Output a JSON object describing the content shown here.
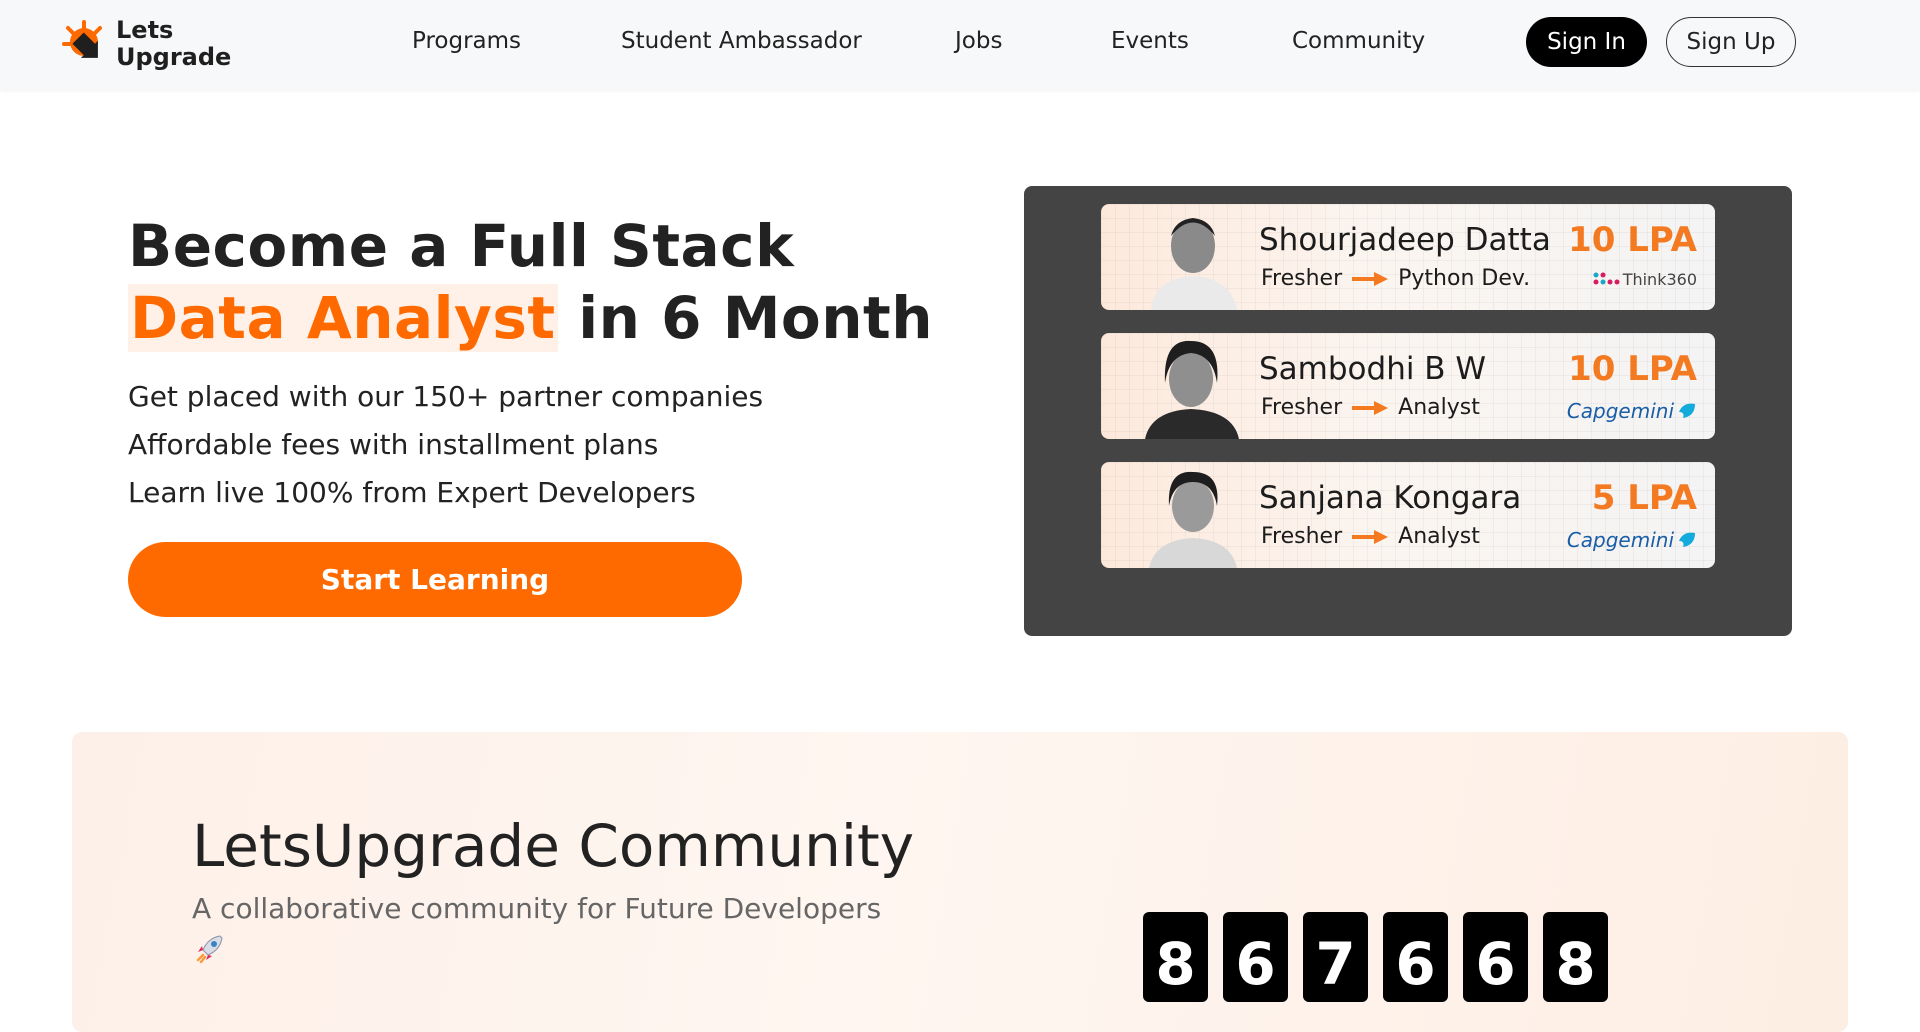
{
  "header": {
    "logo_line1": "Lets",
    "logo_line2": "Upgrade",
    "nav": [
      "Programs",
      "Student Ambassador",
      "Jobs",
      "Events",
      "Community"
    ],
    "sign_in": "Sign In",
    "sign_up": "Sign Up"
  },
  "hero": {
    "title_line1": "Become a Full Stack",
    "title_highlight": "Data Analyst",
    "title_line2_rest": " in 6 Month",
    "lines": [
      "Get placed with our 150+ partner companies",
      "Affordable fees with installment plans",
      "Learn live 100% from Expert Developers"
    ],
    "cta": "Start Learning"
  },
  "placements": [
    {
      "name": "Shourjadeep Datta",
      "from": "Fresher",
      "to": "Python Dev.",
      "package": "10 LPA",
      "company": "Think360"
    },
    {
      "name": "Sambodhi B W",
      "from": "Fresher",
      "to": "Analyst",
      "package": "10 LPA",
      "company": "Capgemini"
    },
    {
      "name": "Sanjana Kongara",
      "from": "Fresher",
      "to": "Analyst",
      "package": "5 LPA",
      "company": "Capgemini"
    }
  ],
  "community": {
    "title": "LetsUpgrade Community",
    "subtitle": "A collaborative community for Future Developers",
    "counter_digits": [
      "8",
      "6",
      "7",
      "6",
      "6",
      "8"
    ]
  },
  "colors": {
    "accent": "#ff6a00",
    "panel": "#444444",
    "dark": "#000000"
  }
}
